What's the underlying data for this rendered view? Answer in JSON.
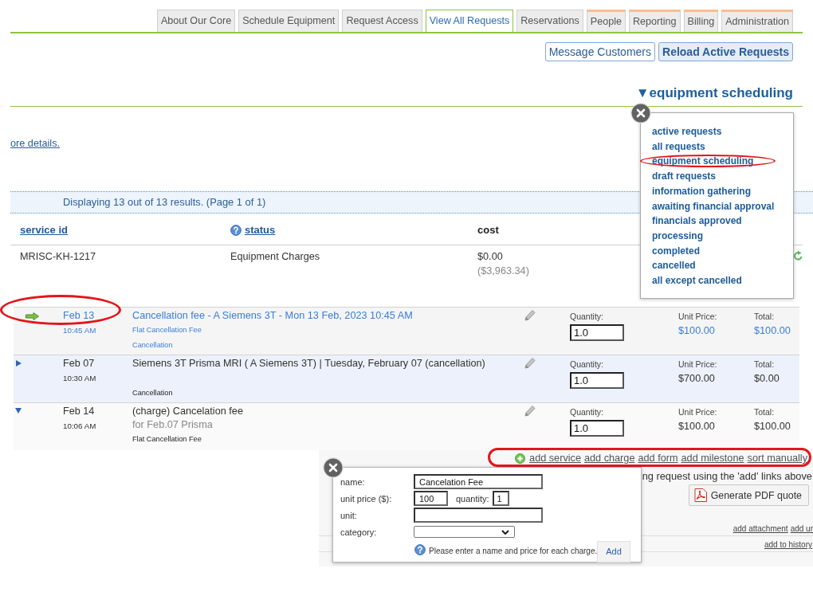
{
  "tabs": [
    {
      "label": "About Our Core",
      "selected": false,
      "kind": "plain"
    },
    {
      "label": "Schedule Equipment",
      "selected": false,
      "kind": "plain"
    },
    {
      "label": "Request Access",
      "selected": false,
      "kind": "plain"
    },
    {
      "label": "View All Requests",
      "selected": true,
      "kind": "plain"
    },
    {
      "label": "Reservations",
      "selected": false,
      "kind": "plain"
    },
    {
      "label": "People",
      "selected": false,
      "kind": "accented"
    },
    {
      "label": "Reporting",
      "selected": false,
      "kind": "accented"
    },
    {
      "label": "Billing",
      "selected": false,
      "kind": "accented"
    },
    {
      "label": "Administration",
      "selected": false,
      "kind": "accented"
    }
  ],
  "actions": [
    {
      "label": "Message Customers",
      "kind": "outline"
    },
    {
      "label": "Reload Active Requests",
      "kind": "strong"
    }
  ],
  "view_menu": {
    "toggle": "▼",
    "title": "equipment scheduling",
    "expanded": true,
    "items": [
      {
        "label": "active requests",
        "circled": false
      },
      {
        "label": "all requests",
        "circled": false
      },
      {
        "label": "equipment scheduling",
        "circled": true
      },
      {
        "label": "draft requests",
        "circled": false
      },
      {
        "label": "information gathering",
        "circled": false
      },
      {
        "label": "awaiting financial approval",
        "circled": false
      },
      {
        "label": "financials approved",
        "circled": false
      },
      {
        "label": "processing",
        "circled": false
      },
      {
        "label": "completed",
        "circled": false
      },
      {
        "label": "cancelled",
        "circled": false
      },
      {
        "label": "all except cancelled",
        "circled": false
      }
    ]
  },
  "details_link": "ore details.",
  "results_summary": "Displaying 13 out of 13 results. (Page 1 of 1)",
  "table": {
    "columns": [
      {
        "label": "service id",
        "kind": "link"
      },
      {
        "label": "status",
        "kind": "help-link"
      },
      {
        "label": "cost",
        "kind": "plain"
      }
    ],
    "rows": [
      {
        "service_id": "MRISC-KH-1217",
        "status": "Equipment Charges",
        "cost": "$0.00",
        "balance": "($3,963.34)"
      }
    ]
  },
  "line_items": [
    {
      "kind": "current",
      "circled": true,
      "date": "Feb 13",
      "time": "10:45 AM",
      "title": "Cancellation fee - A Siemens 3T - Mon 13 Feb, 2023 10:45 AM",
      "detail": "Flat Cancellation Fee",
      "category": "Cancellation",
      "quantity_label": "Quantity:",
      "quantity": "1.0",
      "unit_price_label": "Unit Price:",
      "unit_price": "$100.00",
      "total_label": "Total:",
      "total": "$100.00"
    },
    {
      "kind": "collapsed",
      "circled": false,
      "date": "Feb 07",
      "time": "10:30 AM",
      "title": "Siemens 3T Prisma MRI ( A Siemens 3T) | Tuesday, February 07 (cancellation)",
      "category": "Cancellation",
      "quantity_label": "Quantity:",
      "quantity": "1.0",
      "unit_price_label": "Unit Price:",
      "unit_price": "$700.00",
      "total_label": "Total:",
      "total": "$0.00"
    },
    {
      "kind": "expanded",
      "circled": false,
      "date": "Feb 14",
      "time": "10:06 AM",
      "title": "(charge) Cancelation fee",
      "subtitle": "for Feb.07 Prisma",
      "detail": "Flat Cancellation Fee",
      "quantity_label": "Quantity:",
      "quantity": "1.0",
      "unit_price_label": "Unit Price:",
      "unit_price": "$100.00",
      "total_label": "Total:",
      "total": "$100.00"
    }
  ],
  "add_links": {
    "circled": true,
    "items": [
      "add service",
      "add charge",
      "add form",
      "add milestone",
      "sort manually"
    ]
  },
  "notice": "ng request using the 'add' links above",
  "pdf_button": "Generate PDF quote",
  "attachment_links": [
    "add attachment",
    "add ur"
  ],
  "history_link": "add to history",
  "charge_form": {
    "name": {
      "label": "name:",
      "value": "Cancelation Fee"
    },
    "unit_price": {
      "label": "unit price ($):",
      "value": "100"
    },
    "quantity": {
      "label": "quantity:",
      "value": "1"
    },
    "unit": {
      "label": "unit:"
    },
    "category": {
      "label": "category:"
    },
    "hint": "Please enter a name and price for each charge.",
    "submit": "Add"
  }
}
